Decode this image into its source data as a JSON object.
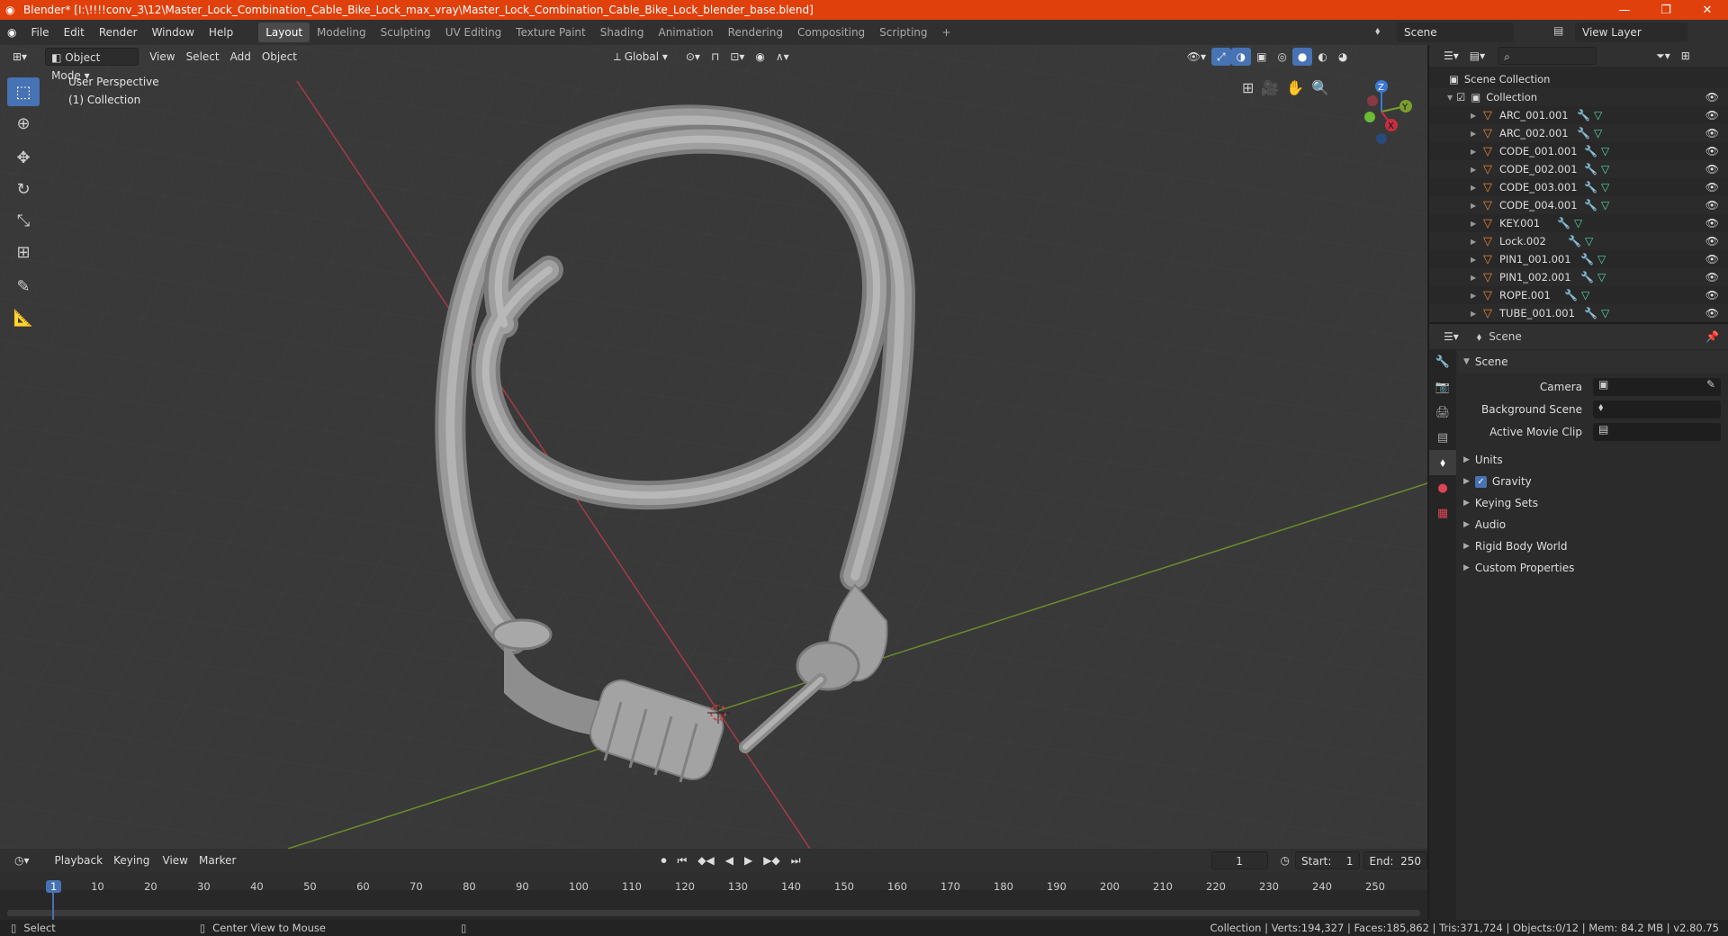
{
  "window": {
    "title": "Blender* [I:\\!!!!conv_3\\12\\Master_Lock_Combination_Cable_Bike_Lock_max_vray\\Master_Lock_Combination_Cable_Bike_Lock_blender_base.blend]",
    "minimize": "—",
    "maximize": "❐",
    "close": "✕"
  },
  "menu": [
    "File",
    "Edit",
    "Render",
    "Window",
    "Help"
  ],
  "workspaces": [
    "Layout",
    "Modeling",
    "Sculpting",
    "UV Editing",
    "Texture Paint",
    "Shading",
    "Animation",
    "Rendering",
    "Compositing",
    "Scripting"
  ],
  "active_workspace": "Layout",
  "scene_name": "Scene",
  "view_layer": "View Layer",
  "viewport_header": {
    "mode": "Object Mode",
    "menus": [
      "View",
      "Select",
      "Add",
      "Object"
    ],
    "orientation": "Global"
  },
  "viewport": {
    "perspective_label": "User Perspective",
    "collection_label": "(1) Collection",
    "gizmo_axes": {
      "x": "X",
      "y": "Y",
      "z": "Z"
    }
  },
  "outliner": {
    "root": "Scene Collection",
    "collection": "Collection",
    "objects": [
      "ARC_001.001",
      "ARC_002.001",
      "CODE_001.001",
      "CODE_002.001",
      "CODE_003.001",
      "CODE_004.001",
      "KEY.001",
      "Lock.002",
      "PIN1_001.001",
      "PIN1_002.001",
      "ROPE.001",
      "TUBE_001.001"
    ]
  },
  "properties": {
    "context": "Scene",
    "panel_title": "Scene",
    "camera_label": "Camera",
    "background_scene_label": "Background Scene",
    "active_movie_clip_label": "Active Movie Clip",
    "subpanels": [
      "Units",
      "Gravity",
      "Keying Sets",
      "Audio",
      "Rigid Body World",
      "Custom Properties"
    ],
    "gravity_checked": true
  },
  "timeline": {
    "menus": [
      "Playback",
      "Keying",
      "View",
      "Marker"
    ],
    "current_frame": "1",
    "start_label": "Start:",
    "start": "1",
    "end_label": "End:",
    "end": "250",
    "ruler": [
      "1",
      "10",
      "20",
      "30",
      "40",
      "50",
      "60",
      "70",
      "80",
      "90",
      "100",
      "110",
      "120",
      "130",
      "140",
      "150",
      "160",
      "170",
      "180",
      "190",
      "200",
      "210",
      "220",
      "230",
      "240",
      "250"
    ]
  },
  "statusbar": {
    "select": "Select",
    "center_view": "Center View to Mouse",
    "stats": "Collection | Verts:194,327 | Faces:185,862 | Tris:371,724 | Objects:0/12 | Mem: 84.2 MB | v2.80.75"
  },
  "colors": {
    "titlebar": "#e0400c",
    "accent": "#4772b3",
    "object_icon": "#e8863a",
    "mesh_icon": "#59d6a0",
    "x_axis": "#c4303f",
    "y_axis": "#7a9f2d"
  }
}
